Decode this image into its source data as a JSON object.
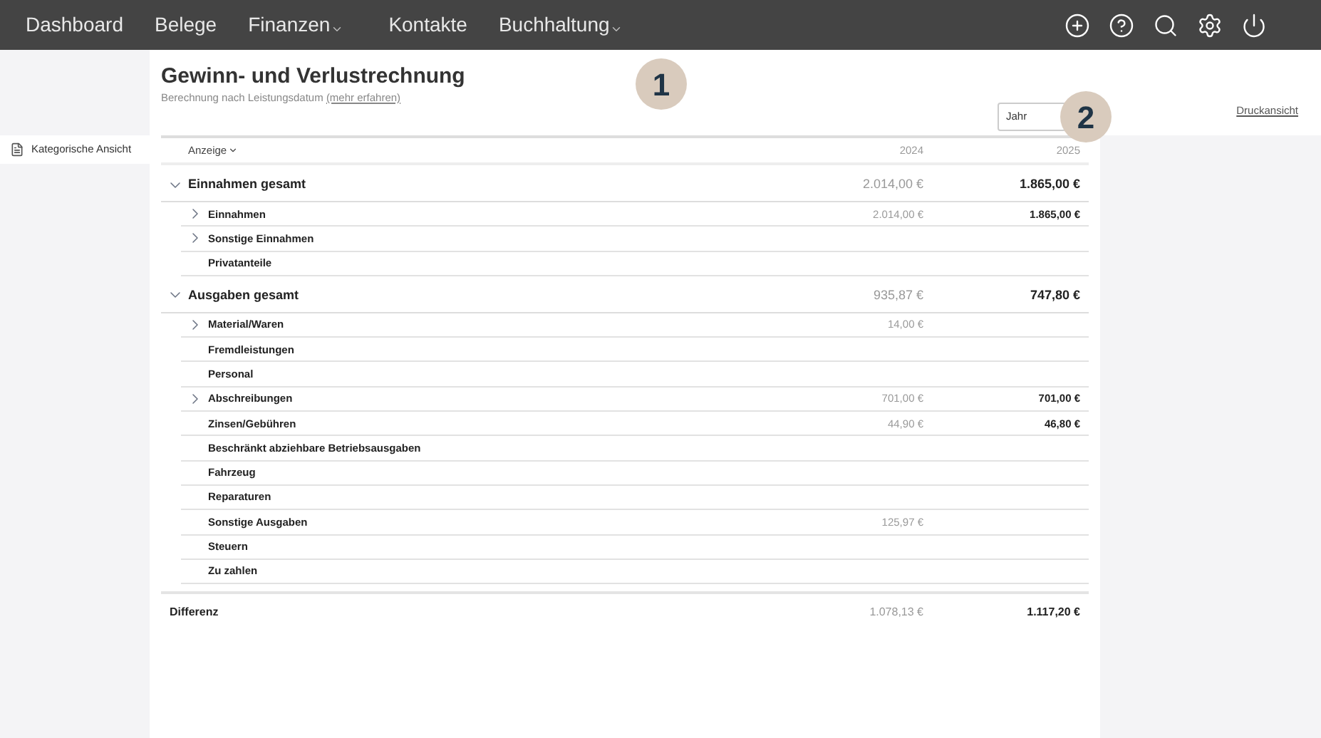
{
  "nav": {
    "items": [
      {
        "label": "Dashboard",
        "dropdown": false
      },
      {
        "label": "Belege",
        "dropdown": false
      },
      {
        "label": "Finanzen",
        "dropdown": true
      },
      {
        "label": "Kontakte",
        "dropdown": false
      },
      {
        "label": "Buchhaltung",
        "dropdown": true
      }
    ]
  },
  "sidebar": {
    "items": [
      {
        "label": "Kategorische Ansicht",
        "selected": true
      }
    ]
  },
  "header": {
    "title": "Gewinn- und Verlustrechnung",
    "subtitle": "Berechnung nach Leistungsdatum",
    "link": "(mehr erfahren)",
    "year_select": "Jahr",
    "print_link": "Druckansicht"
  },
  "markers": [
    "1",
    "2"
  ],
  "table": {
    "view_menu": "Anzeige",
    "columns": [
      "2024",
      "2025"
    ],
    "rows": [
      {
        "kind": "group",
        "expanded": true,
        "label": "Einnahmen gesamt",
        "v2024": "2.014,00 €",
        "v2025": "1.865,00 €"
      },
      {
        "kind": "item",
        "expanded": false,
        "label": "Einnahmen",
        "v2024": "2.014,00 €",
        "v2025": "1.865,00 €"
      },
      {
        "kind": "item",
        "expanded": false,
        "label": "Sonstige Einnahmen"
      },
      {
        "kind": "item",
        "label": "Privatanteile"
      },
      {
        "kind": "group",
        "expanded": true,
        "label": "Ausgaben gesamt",
        "v2024": "935,87 €",
        "v2025": "747,80 €"
      },
      {
        "kind": "item",
        "expanded": false,
        "label": "Material/Waren",
        "v2024": "14,00 €"
      },
      {
        "kind": "item",
        "label": "Fremdleistungen"
      },
      {
        "kind": "item",
        "label": "Personal"
      },
      {
        "kind": "item",
        "expanded": false,
        "label": "Abschreibungen",
        "v2024": "701,00 €",
        "v2025": "701,00 €"
      },
      {
        "kind": "item",
        "label": "Zinsen/Gebühren",
        "v2024": "44,90 €",
        "v2025": "46,80 €"
      },
      {
        "kind": "item",
        "label": "Beschränkt abziehbare Betriebsausgaben"
      },
      {
        "kind": "item",
        "label": "Fahrzeug"
      },
      {
        "kind": "item",
        "label": "Reparaturen"
      },
      {
        "kind": "item",
        "label": "Sonstige Ausgaben",
        "v2024": "125,97 €"
      },
      {
        "kind": "item",
        "label": "Steuern"
      },
      {
        "kind": "item",
        "label": "Zu zahlen"
      },
      {
        "kind": "total",
        "label": "Differenz",
        "v2024": "1.078,13 €",
        "v2025": "1.117,20 €"
      }
    ]
  }
}
